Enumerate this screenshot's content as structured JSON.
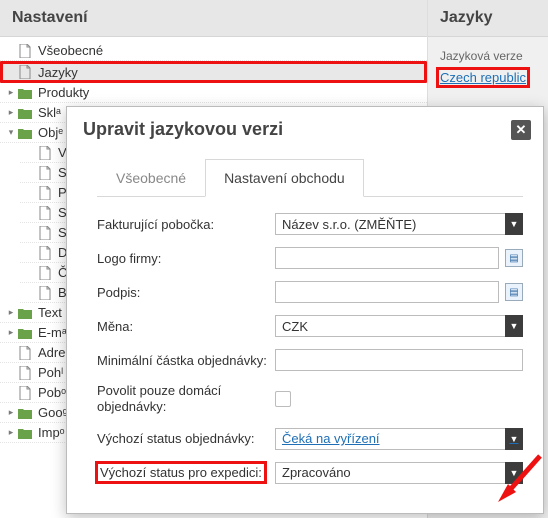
{
  "nav": {
    "header": "Nastavení",
    "items": [
      {
        "label": "Všeobecné",
        "type": "doc"
      },
      {
        "label": "Jazyky",
        "type": "doc",
        "selected": true,
        "highlight": true
      },
      {
        "label": "Produkty",
        "type": "folder",
        "state": "closed"
      },
      {
        "label": "Sklᵃ",
        "type": "folder",
        "state": "closed",
        "cut": true
      },
      {
        "label": "Objᵉ",
        "type": "folder",
        "state": "open",
        "cut": true,
        "children": [
          {
            "label": "Vˢ",
            "type": "doc"
          },
          {
            "label": "Sᵗ",
            "type": "doc"
          },
          {
            "label": "Pˡ",
            "type": "doc"
          },
          {
            "label": "Sᵗ",
            "type": "doc"
          },
          {
            "label": "Sᵏ",
            "type": "doc"
          },
          {
            "label": "D",
            "type": "doc"
          },
          {
            "label": "Č",
            "type": "doc"
          },
          {
            "label": "B",
            "type": "doc"
          }
        ]
      },
      {
        "label": "Text",
        "type": "folder",
        "state": "closed",
        "cut": true
      },
      {
        "label": "E-mᵃ",
        "type": "folder",
        "state": "closed",
        "cut": true
      },
      {
        "label": "Adreˢ",
        "type": "doc",
        "cut": true
      },
      {
        "label": "Pohˡ",
        "type": "doc",
        "cut": true
      },
      {
        "label": "Pobᵒ",
        "type": "doc",
        "cut": true
      },
      {
        "label": "Gooᵍ",
        "type": "folder",
        "state": "closed",
        "cut": true
      },
      {
        "label": "Impᵒ",
        "type": "folder",
        "state": "closed",
        "cut": true
      }
    ]
  },
  "side": {
    "header": "Jazyky",
    "subhead": "Jazyková verze",
    "link": "Czech republic"
  },
  "modal": {
    "title": "Upravit jazykovou verzi",
    "tabs": [
      "Všeobecné",
      "Nastavení obchodu"
    ],
    "active_tab": 1,
    "rows": {
      "branch": {
        "label": "Fakturující pobočka:",
        "value": "Název s.r.o. (ZMĚŇTE)"
      },
      "logo": {
        "label": "Logo firmy:"
      },
      "sign": {
        "label": "Podpis:"
      },
      "currency": {
        "label": "Měna:",
        "value": "CZK"
      },
      "minorder": {
        "label": "Minimální částka objednávky:"
      },
      "domestic": {
        "label": "Povolit pouze domácí objednávky:"
      },
      "status_order": {
        "label": "Výchozí status objednávky:",
        "value": "Čeká na vyřízení"
      },
      "status_ship": {
        "label": "Výchozí status pro expedici:",
        "value": "Zpracováno"
      }
    }
  }
}
